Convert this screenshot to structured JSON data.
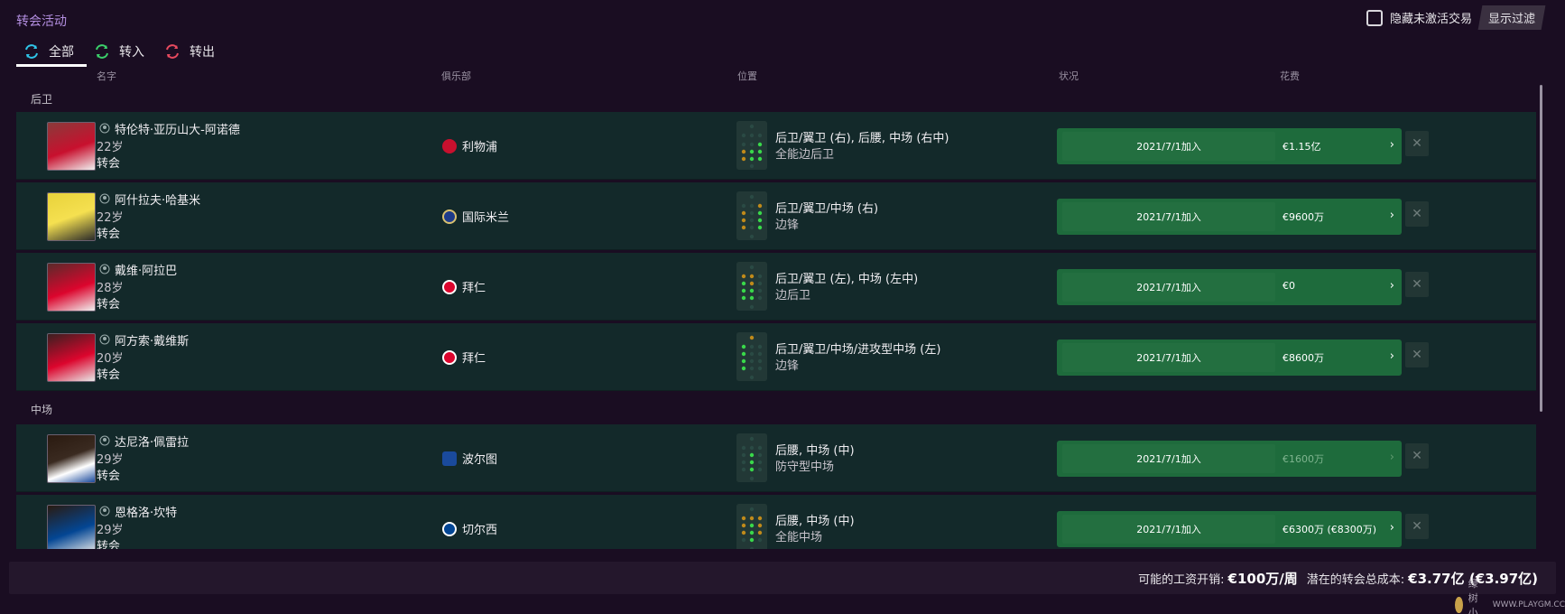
{
  "header": {
    "title": "转会活动",
    "hide_inactive_label": "隐藏未激活交易",
    "filter_button": "显示过滤"
  },
  "tabs": [
    {
      "label": "全部",
      "icon": "transfer-both-icon",
      "active": true,
      "color": "#2fc4e8"
    },
    {
      "label": "转入",
      "icon": "transfer-in-icon",
      "active": false,
      "color": "#3bd06a"
    },
    {
      "label": "转出",
      "icon": "transfer-out-icon",
      "active": false,
      "color": "#e84a5f"
    }
  ],
  "columns": {
    "name": "名字",
    "club": "俱乐部",
    "position": "位置",
    "status": "状况",
    "fee": "花费"
  },
  "groups": [
    {
      "label": "后卫",
      "players": [
        {
          "name": "特伦特·亚历山大-阿诺德",
          "age": "22岁",
          "type": "转会",
          "club": "利物浦",
          "club_color": "#c8102e",
          "position": "后卫/翼卫 (右), 后腰, 中场 (右中)",
          "role": "全能边后卫",
          "date": "2021/7/1加入",
          "fee": "€1.15亿",
          "fee_muted": false
        },
        {
          "name": "阿什拉夫·哈基米",
          "age": "22岁",
          "type": "转会",
          "club": "国际米兰",
          "club_color": "#1e3b8a",
          "position": "后卫/翼卫/中场 (右)",
          "role": "边锋",
          "date": "2021/7/1加入",
          "fee": "€9600万",
          "fee_muted": false
        },
        {
          "name": "戴维·阿拉巴",
          "age": "28岁",
          "type": "转会",
          "club": "拜仁",
          "club_color": "#dc052d",
          "position": "后卫/翼卫 (左), 中场 (左中)",
          "role": "边后卫",
          "date": "2021/7/1加入",
          "fee": "€0",
          "fee_muted": false
        },
        {
          "name": "阿方索·戴维斯",
          "age": "20岁",
          "type": "转会",
          "club": "拜仁",
          "club_color": "#dc052d",
          "position": "后卫/翼卫/中场/进攻型中场 (左)",
          "role": "边锋",
          "date": "2021/7/1加入",
          "fee": "€8600万",
          "fee_muted": false
        }
      ]
    },
    {
      "label": "中场",
      "players": [
        {
          "name": "达尼洛·佩雷拉",
          "age": "29岁",
          "type": "转会",
          "club": "波尔图",
          "club_color": "#1a4a9c",
          "position": "后腰, 中场 (中)",
          "role": "防守型中场",
          "date": "2021/7/1加入",
          "fee": "€1600万",
          "fee_muted": true
        },
        {
          "name": "恩格洛·坎特",
          "age": "29岁",
          "type": "转会",
          "club": "切尔西",
          "club_color": "#034694",
          "position": "后腰, 中场 (中)",
          "role": "全能中场",
          "date": "2021/7/1加入",
          "fee": "€6300万 (€8300万)",
          "fee_muted": false
        }
      ]
    }
  ],
  "footer": {
    "wage_label": "可能的工资开销:",
    "wage_value": "€100万/周",
    "total_label": "潜在的转会总成本:",
    "total_value": "€3.77亿 (€3.97亿)"
  },
  "watermark": {
    "line1": "绿树小组",
    "line2": "WWW.PLAYGM.CC"
  },
  "colors": {
    "background": "#1a0d22",
    "row_bg": "#13292a",
    "status_green": "#1e6b3c",
    "title_purple": "#b38ee0"
  }
}
